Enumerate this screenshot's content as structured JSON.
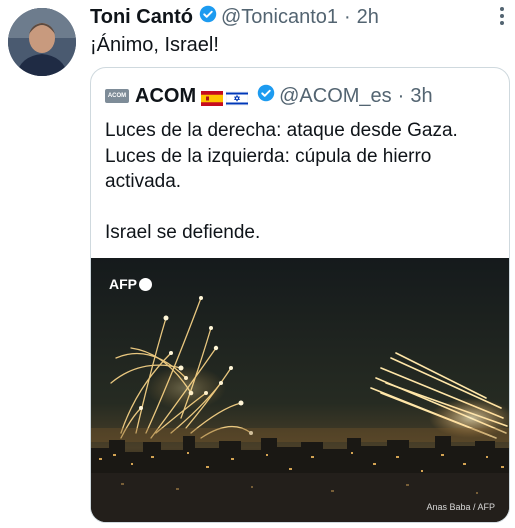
{
  "tweet": {
    "name": "Toni Cantó",
    "handle": "@Tonicanto1",
    "separator": "·",
    "time": "2h",
    "text": "¡Ánimo, Israel!",
    "more_icon": "more-vertical-icon"
  },
  "quote": {
    "logo_text": "ACOM",
    "name": "ACOM",
    "handle": "@ACOM_es",
    "separator": "·",
    "time": "3h",
    "flags": [
      "spain-flag-icon",
      "israel-flag-icon"
    ],
    "lines": [
      "Luces de la derecha: ataque desde Gaza.",
      "Luces de la izquierda: cúpula de hierro activada.",
      "",
      "Israel se defiende."
    ],
    "photo": {
      "agency_logo": "AFP",
      "credit": "Anas Baba / AFP"
    }
  },
  "colors": {
    "verified": "#1d9bf0",
    "secondary_text": "#536471",
    "border": "#cfd9de"
  }
}
